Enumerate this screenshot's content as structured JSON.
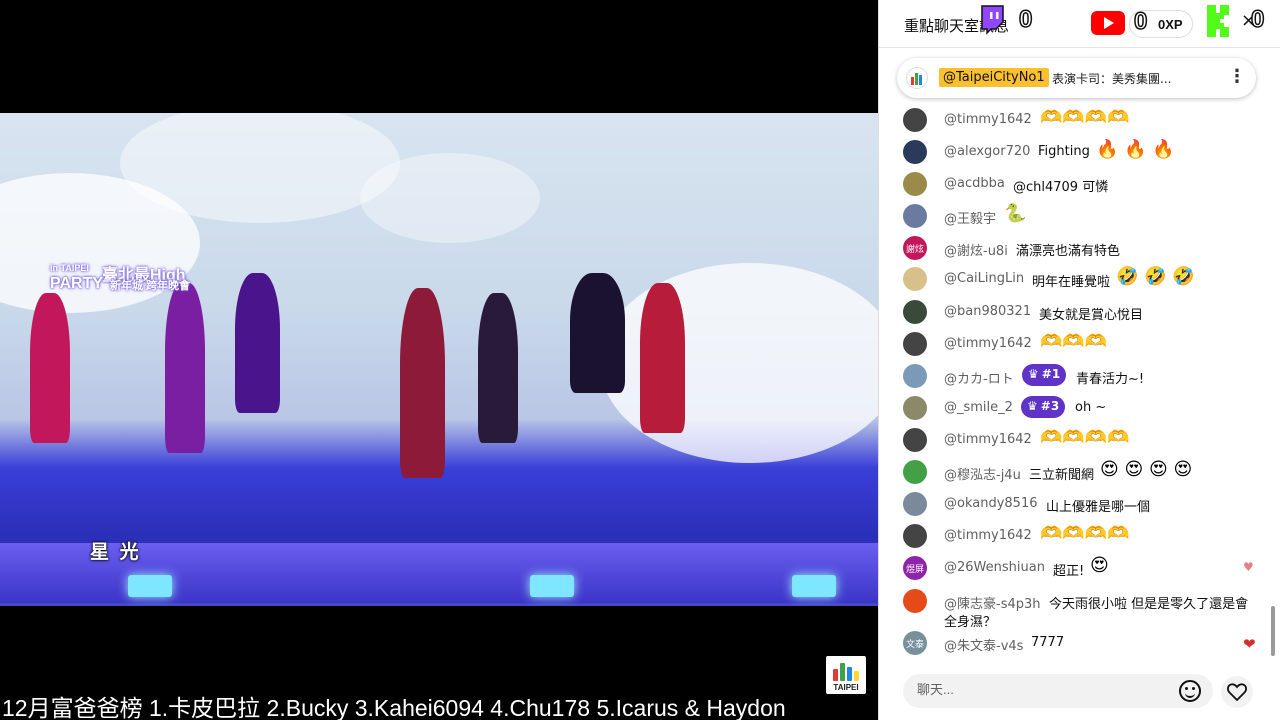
{
  "video": {
    "logo_line1": "in TAIPEI",
    "logo_line2": "臺北最High",
    "logo_line3": "PARTY",
    "logo_line4": "新年城 跨年晚會",
    "song_caption": "星 光",
    "taipei_logo": "TAIPEI",
    "ticker": "12月富爸爸榜   1.卡皮巴拉 2.Bucky 3.Kahei6094 4.Chu178 5.Icarus & Haydon"
  },
  "chat_header": {
    "title": "重點聊天室訊息",
    "twitch_count": "0",
    "youtube_count": "0",
    "xp_label": "0XP",
    "kick_count": "0",
    "close": "×"
  },
  "pinned": {
    "author": "@TaipeiCityNo1",
    "message": "表演卡司：美秀集團...",
    "menu": "⋮"
  },
  "messages": [
    {
      "author": "@timmy1642",
      "text": "",
      "emoji": "🫶🫶🫶🫶",
      "avatar_color": "#444"
    },
    {
      "author": "@alexgor720",
      "text": "Fighting",
      "emoji": "🔥 🔥 🔥",
      "avatar_color": "#2a3a5a"
    },
    {
      "author": "@acdbba",
      "text": "@chl4709 可憐",
      "emoji": "",
      "avatar_color": "#9b8a4a"
    },
    {
      "author": "@王毅宇",
      "text": "",
      "emoji": "🐍",
      "avatar_color": "#6a7aa0"
    },
    {
      "author": "@謝炫-u8i",
      "text": "滿漂亮也滿有特色",
      "emoji": "",
      "avatar_color": "#c2185b",
      "avatar_text": "謝炫"
    },
    {
      "author": "@CaiLingLin",
      "text": "明年在睡覺啦",
      "emoji": "🤣 🤣 🤣",
      "avatar_color": "#d8c08a"
    },
    {
      "author": "@ban980321",
      "text": "美女就是賞心悅目",
      "emoji": "",
      "avatar_color": "#3a4a3a"
    },
    {
      "author": "@timmy1642",
      "text": "",
      "emoji": "🫶🫶🫶",
      "avatar_color": "#444"
    },
    {
      "author": "@カカ-ロト",
      "text": "青春活力~!",
      "emoji": "",
      "avatar_color": "#7a9ab8",
      "badge": "#1"
    },
    {
      "author": "@_smile_2",
      "text": "oh ~",
      "emoji": "",
      "avatar_color": "#8a8a6a",
      "badge": "#3"
    },
    {
      "author": "@timmy1642",
      "text": "",
      "emoji": "🫶🫶🫶🫶",
      "avatar_color": "#444"
    },
    {
      "author": "@穆泓志-j4u",
      "text": "三立新聞網",
      "emoji": "😍 😍 😍 😍",
      "avatar_color": "#43a047"
    },
    {
      "author": "@okandy8516",
      "text": "山上優雅是哪一個",
      "emoji": "",
      "avatar_color": "#7a8a9a"
    },
    {
      "author": "@timmy1642",
      "text": "",
      "emoji": "🫶🫶🫶🫶",
      "avatar_color": "#444"
    },
    {
      "author": "@26Wenshiuan",
      "text": "超正!",
      "emoji": "😍",
      "avatar_color": "#8e24aa",
      "avatar_text": "煜屏",
      "heart": "♥"
    },
    {
      "author": "@陳志豪-s4p3h",
      "text": "今天雨很小啦 但是是零久了還是會",
      "text2": "全身濕？",
      "emoji": "",
      "avatar_color": "#e64a19"
    },
    {
      "author": "@朱文泰-v4s",
      "text": "7777",
      "emoji": "",
      "avatar_color": "#78909c",
      "avatar_text": "文泰",
      "heart": "❤"
    }
  ],
  "input": {
    "placeholder": "聊天..."
  }
}
